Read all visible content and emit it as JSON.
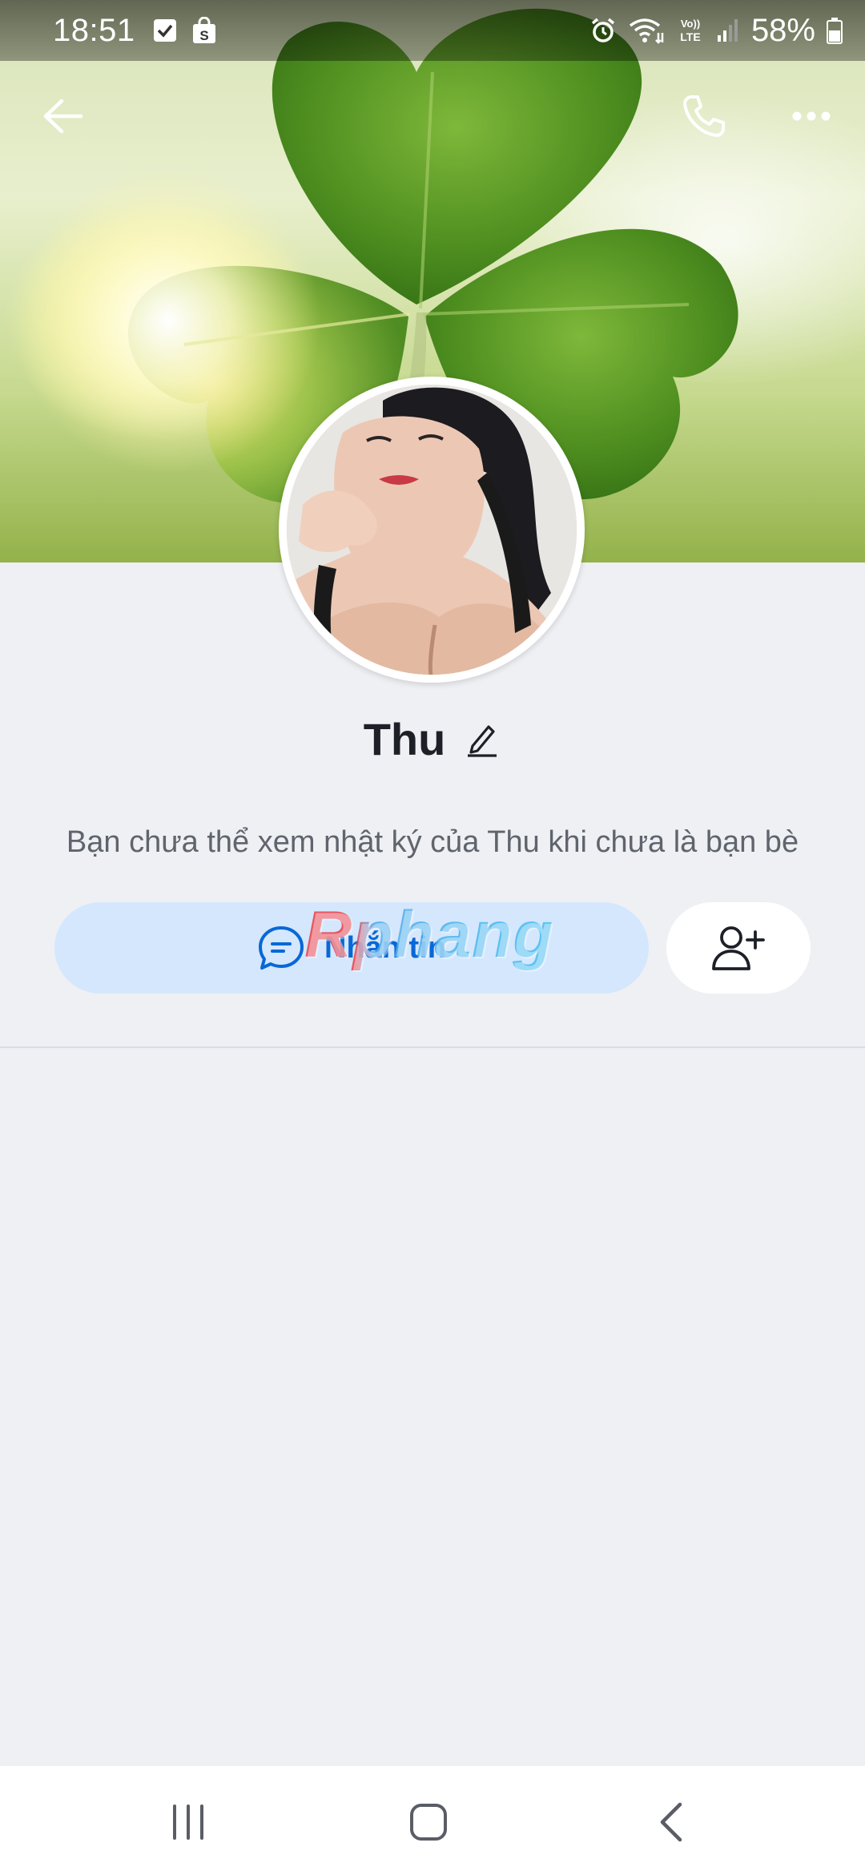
{
  "status_bar": {
    "time": "18:51",
    "battery": "58%",
    "left_icons": [
      "checkbox-notification-icon",
      "shopee-bag-icon"
    ],
    "right_icons": [
      "alarm-icon",
      "wifi-icon",
      "volte-icon",
      "signal-icon",
      "battery-icon"
    ],
    "volte_label_top": "Vo))",
    "volte_label_bottom": "LTE"
  },
  "top_bar": {
    "icons": [
      "back-arrow-icon",
      "phone-icon",
      "more-icon"
    ]
  },
  "profile": {
    "name": "Thu",
    "info": "Bạn chưa thể xem nhật ký của Thu khi chưa là bạn bè"
  },
  "actions": {
    "message_label": "Nhắn tin",
    "message_icon": "chat-bubble-icon",
    "add_friend_icon": "add-friend-icon"
  },
  "watermark": "Rphang",
  "nav_bar": {
    "icons": [
      "recents-icon",
      "home-icon",
      "back-icon"
    ]
  },
  "colors": {
    "accent": "#0868d6",
    "message_button_bg": "#d4e7fd",
    "page_bg": "#eff0f4",
    "name_text": "#1d2026",
    "info_text": "#5f646d"
  }
}
